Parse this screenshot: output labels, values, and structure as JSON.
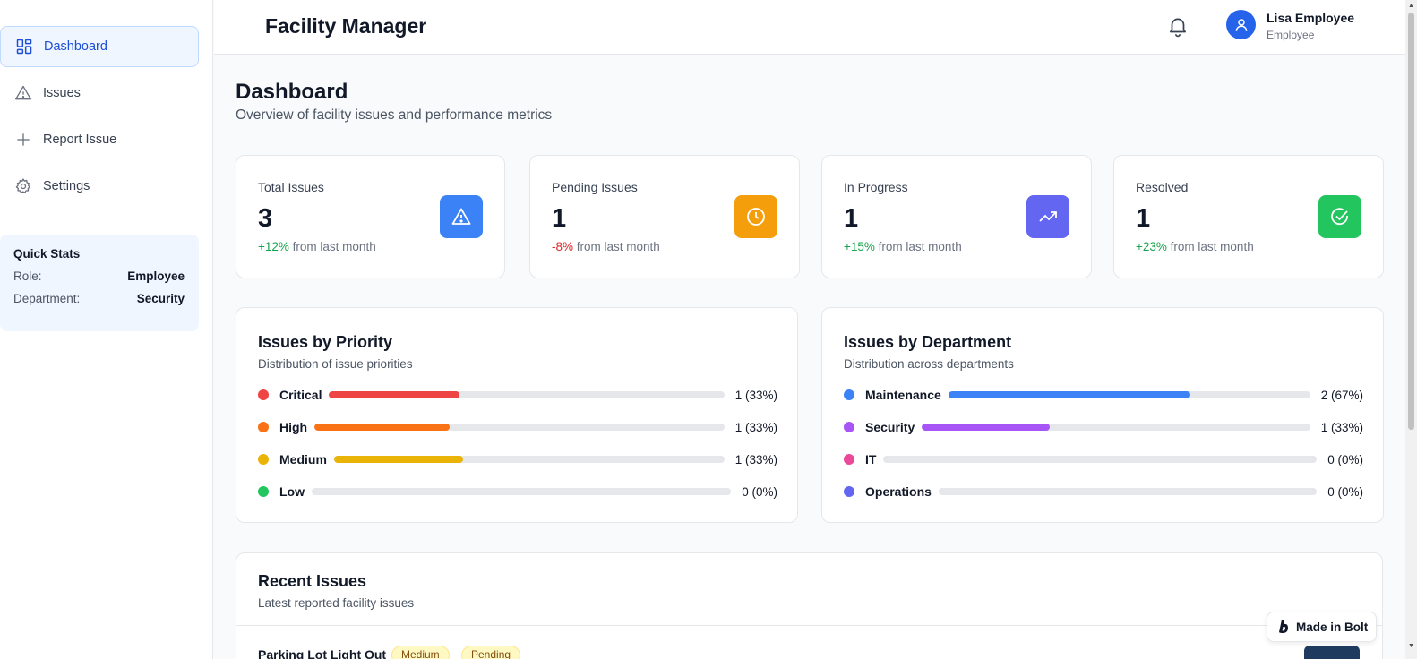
{
  "sidebar": {
    "items": [
      {
        "label": "Dashboard",
        "icon": "dashboard-icon",
        "active": true
      },
      {
        "label": "Issues",
        "icon": "warning-triangle-icon",
        "active": false
      },
      {
        "label": "Report Issue",
        "icon": "plus-icon",
        "active": false
      },
      {
        "label": "Settings",
        "icon": "gear-icon",
        "active": false
      }
    ],
    "quick_stats": {
      "title": "Quick Stats",
      "role_label": "Role:",
      "role_value": "Employee",
      "department_label": "Department:",
      "department_value": "Security"
    }
  },
  "header": {
    "app_title": "Facility Manager",
    "user_name": "Lisa Employee",
    "user_role": "Employee"
  },
  "page": {
    "title": "Dashboard",
    "subtitle": "Overview of facility issues and performance metrics"
  },
  "stats": [
    {
      "label": "Total Issues",
      "value": "3",
      "change": "+12%",
      "change_suffix": "from last month",
      "trend": "positive",
      "icon": "warning-triangle-icon",
      "color": "#3b82f6"
    },
    {
      "label": "Pending Issues",
      "value": "1",
      "change": "-8%",
      "change_suffix": "from last month",
      "trend": "negative",
      "icon": "clock-icon",
      "color": "#f59e0b"
    },
    {
      "label": "In Progress",
      "value": "1",
      "change": "+15%",
      "change_suffix": "from last month",
      "trend": "positive",
      "icon": "trending-up-icon",
      "color": "#6366f1"
    },
    {
      "label": "Resolved",
      "value": "1",
      "change": "+23%",
      "change_suffix": "from last month",
      "trend": "positive",
      "icon": "check-circle-icon",
      "color": "#22c55e"
    }
  ],
  "priority_panel": {
    "title": "Issues by Priority",
    "subtitle": "Distribution of issue priorities",
    "rows": [
      {
        "label": "Critical",
        "count": 1,
        "percent": 33,
        "value_text": "1 (33%)",
        "color": "#ef4444"
      },
      {
        "label": "High",
        "count": 1,
        "percent": 33,
        "value_text": "1 (33%)",
        "color": "#f97316"
      },
      {
        "label": "Medium",
        "count": 1,
        "percent": 33,
        "value_text": "1 (33%)",
        "color": "#eab308"
      },
      {
        "label": "Low",
        "count": 0,
        "percent": 0,
        "value_text": "0 (0%)",
        "color": "#22c55e"
      }
    ]
  },
  "department_panel": {
    "title": "Issues by Department",
    "subtitle": "Distribution across departments",
    "rows": [
      {
        "label": "Maintenance",
        "count": 2,
        "percent": 67,
        "value_text": "2 (67%)",
        "color": "#3b82f6"
      },
      {
        "label": "Security",
        "count": 1,
        "percent": 33,
        "value_text": "1 (33%)",
        "color": "#a855f7"
      },
      {
        "label": "IT",
        "count": 0,
        "percent": 0,
        "value_text": "0 (0%)",
        "color": "#ec4899"
      },
      {
        "label": "Operations",
        "count": 0,
        "percent": 0,
        "value_text": "0 (0%)",
        "color": "#6366f1"
      }
    ]
  },
  "recent": {
    "title": "Recent Issues",
    "subtitle": "Latest reported facility issues",
    "items": [
      {
        "title": "Parking Lot Light Out",
        "priority": "Medium",
        "status": "Pending"
      }
    ]
  },
  "bolt_badge": {
    "label": "Made in Bolt"
  }
}
